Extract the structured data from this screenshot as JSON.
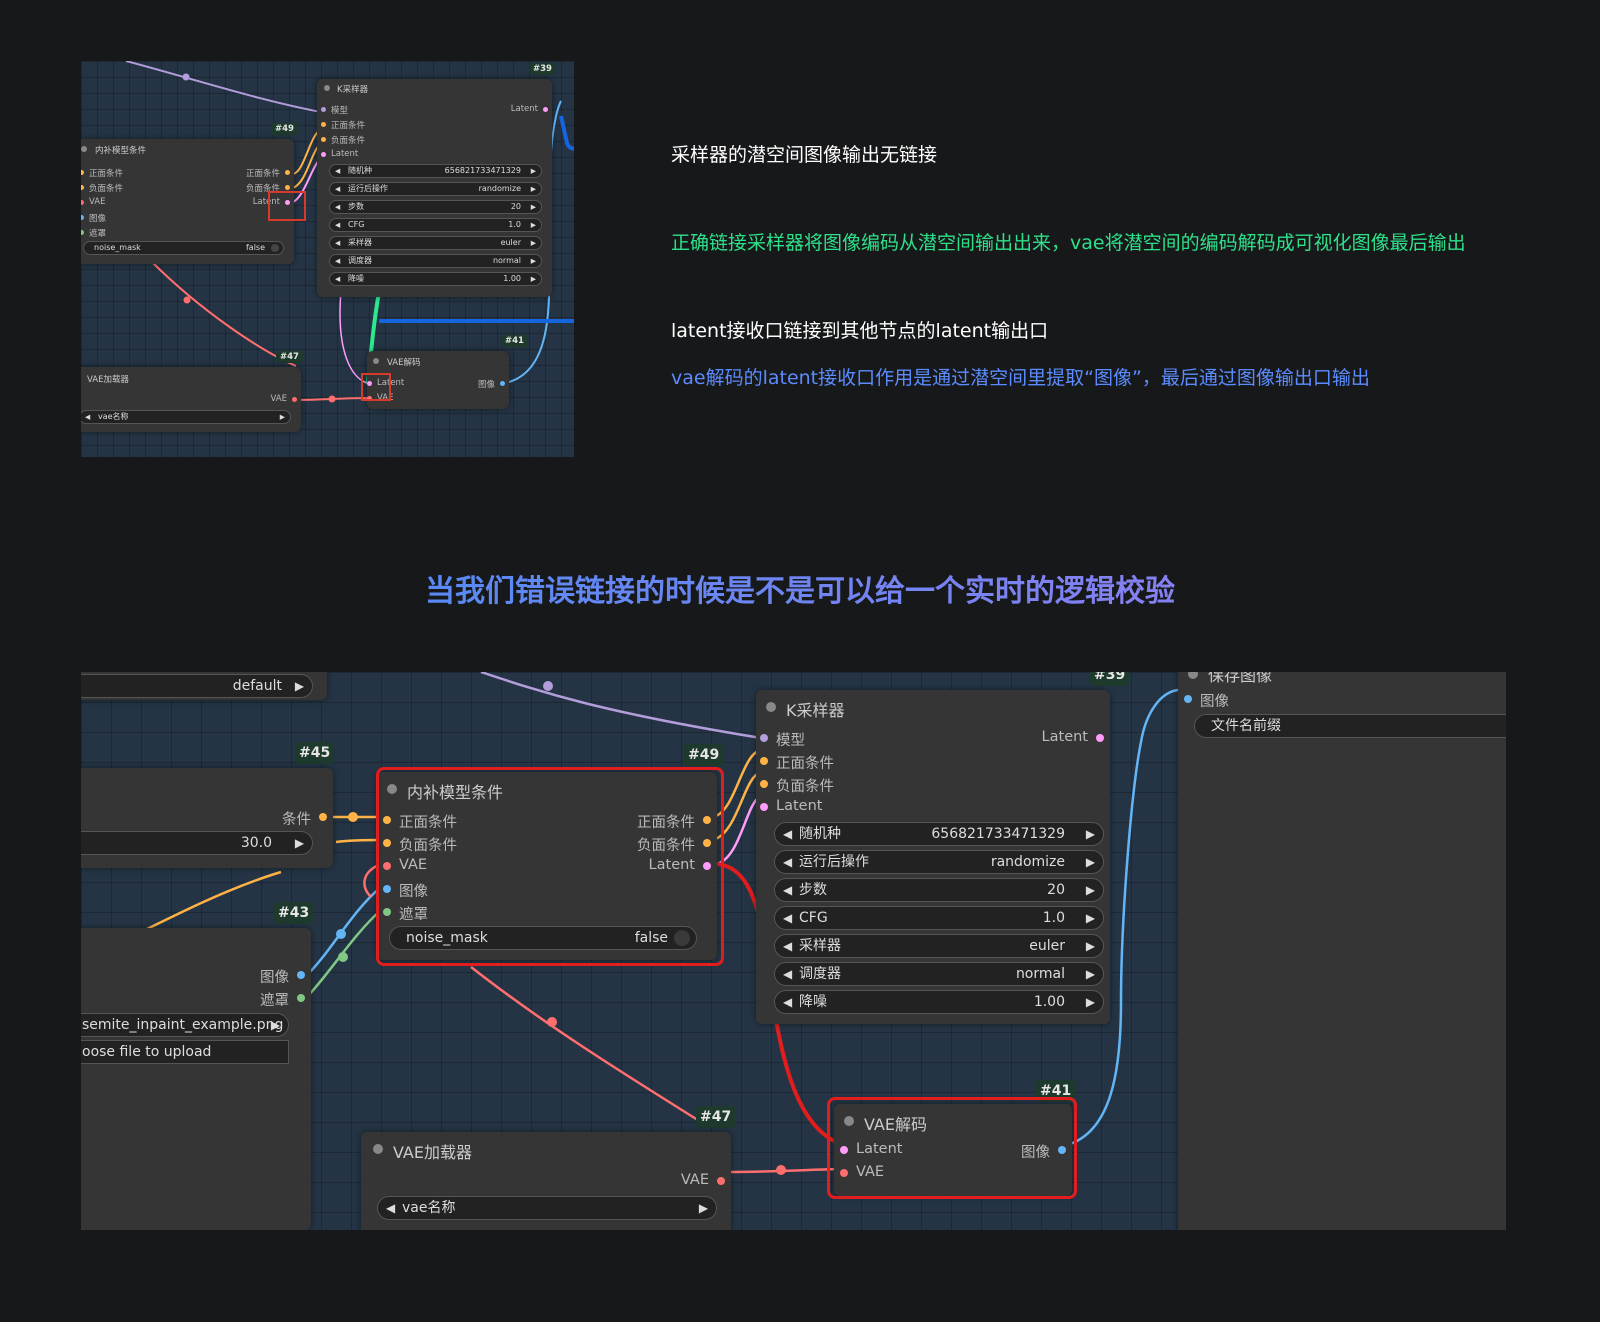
{
  "colors": {
    "model": "#b39ddb",
    "cond": "#ffb347",
    "latent": "#ff9cf9",
    "vae": "#ff6e6e",
    "image": "#64b5f6",
    "mask": "#81c784",
    "highlight": "#e11d1d",
    "wire_correct": "#2ee88e",
    "arrow_blue": "#1565e0",
    "text_green": "#2fe08a",
    "text_blue": "#5b8cff",
    "title_gradient": [
      "#3f8ef5",
      "#9f7cf0"
    ]
  },
  "annotations": {
    "a1": "采样器的潜空间图像输出无链接",
    "a2": "正确链接采样器将图像编码从潜空间输出出来，vae将潜空间的编码解码成可视化图像最后输出",
    "a3": "latent接收口链接到其他节点的latent输出口",
    "a4": "vae解码的latent接收口作用是通过潜空间里提取“图像”，最后通过图像输出口输出"
  },
  "title": "当我们错误链接的时候是不是可以给一个实时的逻辑校验",
  "ksampler": {
    "badge": "#39",
    "title": "K采样器",
    "inputs": [
      "模型",
      "正面条件",
      "负面条件",
      "Latent"
    ],
    "output": "Latent",
    "widgets": [
      {
        "label": "随机种",
        "value": "656821733471329"
      },
      {
        "label": "运行后操作",
        "value": "randomize"
      },
      {
        "label": "步数",
        "value": "20"
      },
      {
        "label": "CFG",
        "value": "1.0"
      },
      {
        "label": "采样器",
        "value": "euler"
      },
      {
        "label": "调度器",
        "value": "normal"
      },
      {
        "label": "降噪",
        "value": "1.00"
      }
    ]
  },
  "inpaint": {
    "badge": "#49",
    "title": "内补模型条件",
    "inputs": [
      "正面条件",
      "负面条件",
      "VAE",
      "图像",
      "遮罩"
    ],
    "outputs": [
      "正面条件",
      "负面条件",
      "Latent"
    ],
    "toggle": {
      "label": "noise_mask",
      "value": "false"
    }
  },
  "vae_loader": {
    "badge": "#47",
    "title": "VAE加载器",
    "output": "VAE",
    "widget": "vae名称"
  },
  "vae_decode": {
    "badge": "#41",
    "title": "VAE解码",
    "inputs": [
      "Latent",
      "VAE"
    ],
    "output": "图像"
  },
  "partial": {
    "default_value": "default",
    "n45_badge": "#45",
    "n45_output": "条件",
    "n45_value": "30.0",
    "n43_badge": "#43",
    "n43_outputs": [
      "图像",
      "遮罩"
    ],
    "n43_file": "semite_inpaint_example.png",
    "n43_upload": "oose file to upload",
    "save_title": "保存图像",
    "save_input": "图像",
    "save_widget": "文件名前缀"
  }
}
